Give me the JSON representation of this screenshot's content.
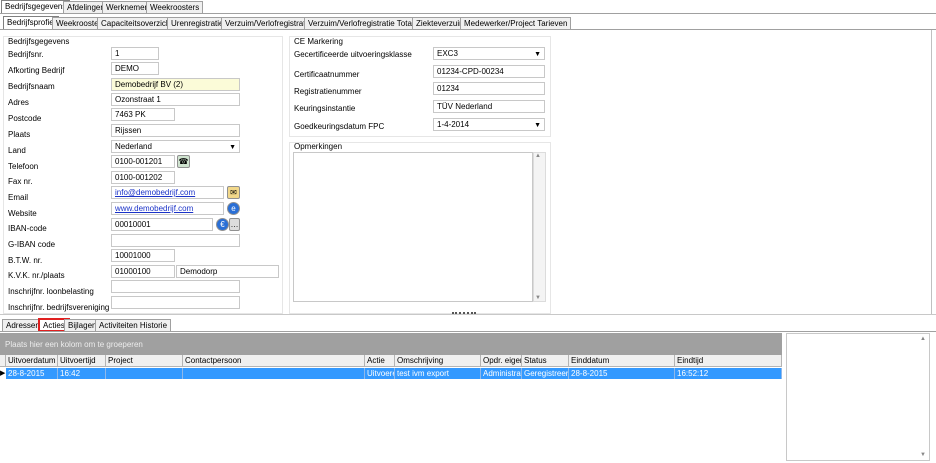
{
  "top_tabs": [
    "Bedrijfsgegevens",
    "Afdelingen",
    "Werknemers",
    "Weekroosters"
  ],
  "sub_tabs": [
    "Bedrijfsprofiel",
    "Weekrooster",
    "Capaciteitsoverzicht",
    "Urenregistratie",
    "Verzuim/Verlofregistratie",
    "Verzuim/Verlofregistratie Totalen",
    "Ziekteverzuim",
    "Medewerker/Project Tarieven"
  ],
  "company": {
    "section_title": "Bedrijfsgegevens",
    "fields": {
      "bedrijfsnr": {
        "label": "Bedrijfsnr.",
        "value": "1"
      },
      "afkorting": {
        "label": "Afkorting Bedrijf",
        "value": "DEMO"
      },
      "bedrijfsnaam": {
        "label": "Bedrijfsnaam",
        "value": "Demobedrijf BV (2)"
      },
      "adres": {
        "label": "Adres",
        "value": "Ozonstraat 1"
      },
      "postcode": {
        "label": "Postcode",
        "value": "7463 PK"
      },
      "plaats": {
        "label": "Plaats",
        "value": "Rijssen"
      },
      "land": {
        "label": "Land",
        "value": "Nederland"
      },
      "telefoon": {
        "label": "Telefoon",
        "value": "0100-001201"
      },
      "fax": {
        "label": "Fax nr.",
        "value": "0100-001202"
      },
      "email": {
        "label": "Email",
        "value": "info@demobedrijf.com"
      },
      "website": {
        "label": "Website",
        "value": "www.demobedrijf.com"
      },
      "iban": {
        "label": "IBAN-code",
        "value": "00010001"
      },
      "giban": {
        "label": "G-IBAN code",
        "value": ""
      },
      "btw": {
        "label": "B.T.W. nr.",
        "value": "10001000"
      },
      "kvk": {
        "label": "K.V.K. nr./plaats",
        "value": "01000100",
        "value2": "Demodorp"
      },
      "loonbelasting": {
        "label": "Inschrijfnr. loonbelasting",
        "value": ""
      },
      "bedrijfsvereniging": {
        "label": "Inschrijfnr. bedrijfsvereniging",
        "value": ""
      }
    }
  },
  "ce": {
    "section_title": "CE Markering",
    "fields": {
      "klasse": {
        "label": "Gecertificeerde uitvoeringsklasse",
        "value": "EXC3"
      },
      "certificaat": {
        "label": "Certificaatnummer",
        "value": "01234-CPD-00234"
      },
      "registratie": {
        "label": "Registratienummer",
        "value": "01234"
      },
      "keuring": {
        "label": "Keuringsinstantie",
        "value": "TÜV Nederland"
      },
      "datum": {
        "label": "Goedkeuringsdatum FPC",
        "value": "1-4-2014"
      }
    }
  },
  "opmerkingen": {
    "label": "Opmerkingen",
    "value": ""
  },
  "bottom_tabs": [
    "Adressen",
    "Acties",
    "Bijlagen",
    "Activiteiten Historie"
  ],
  "group_hint": "Plaats hier een kolom om te groeperen",
  "grid": {
    "columns": [
      "Uitvoerdatum",
      "Uitvoertijd",
      "Project",
      "Contactpersoon",
      "Actie",
      "Omschrijving",
      "Opdr. eiger",
      "Status",
      "Einddatum",
      "Eindtijd"
    ],
    "rows": [
      [
        "28-8-2015",
        "16:42",
        "",
        "",
        "Uitvoeren",
        "test ivm export",
        "Administrat",
        "Geregistreerd",
        "28-8-2015",
        "16:52:12"
      ]
    ]
  },
  "colors": {
    "selection": "#3399ff",
    "highlight_border": "#e02020",
    "group_bar": "#a0a0a0"
  }
}
